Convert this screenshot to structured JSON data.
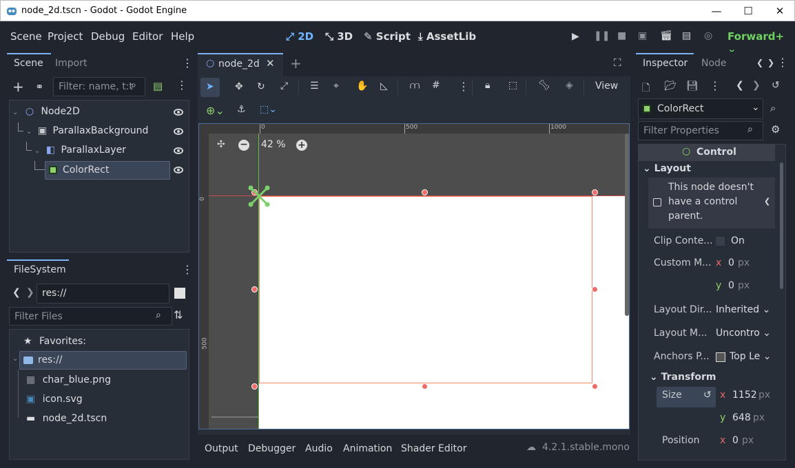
{
  "window": {
    "title": "node_2d.tscn - Godot - Godot Engine",
    "minimize": "—",
    "maximize": "☐",
    "close": "✕"
  },
  "menu": [
    "Scene",
    "Project",
    "Debug",
    "Editor",
    "Help"
  ],
  "workspaces": [
    {
      "label": "2D",
      "icon": "2d-icon",
      "active": true
    },
    {
      "label": "3D",
      "icon": "3d-icon",
      "active": false
    },
    {
      "label": "Script",
      "icon": "script-icon",
      "active": false
    },
    {
      "label": "AssetLib",
      "icon": "assetlib-icon",
      "active": false
    }
  ],
  "renderer": "Forward+",
  "scene_dock": {
    "tabs": [
      "Scene",
      "Import"
    ],
    "filter_placeholder": "Filter: name, t:t",
    "nodes": [
      {
        "label": "Node2D",
        "icon": "node2d-icon"
      },
      {
        "label": "ParallaxBackground",
        "icon": "parallax-background-icon"
      },
      {
        "label": "ParallaxLayer",
        "icon": "parallax-layer-icon"
      },
      {
        "label": "ColorRect",
        "icon": "colorrect-icon",
        "selected": true
      }
    ]
  },
  "filesystem": {
    "tab": "FileSystem",
    "path": "res://",
    "filter_placeholder": "Filter Files",
    "items": [
      {
        "label": "Favorites:",
        "icon": "star-icon"
      },
      {
        "label": "res://",
        "icon": "folder-icon",
        "selected": true
      },
      {
        "label": "char_blue.png",
        "icon": "image-icon"
      },
      {
        "label": "icon.svg",
        "icon": "svg-icon"
      },
      {
        "label": "node_2d.tscn",
        "icon": "scene-icon"
      }
    ]
  },
  "editor": {
    "tab": "node_2d",
    "zoom": "42 %",
    "view_menu": "View",
    "ruler_top": [
      "0",
      "500",
      "1000"
    ],
    "ruler_left": [
      "0",
      "500"
    ]
  },
  "bottom_panel": {
    "tabs": [
      "Output",
      "Debugger",
      "Audio",
      "Animation",
      "Shader Editor"
    ],
    "version": "4.2.1.stable.mono"
  },
  "inspector": {
    "tabs": [
      "Inspector",
      "Node"
    ],
    "node_selector": "ColorRect",
    "filter_placeholder": "Filter Properties",
    "class_header": "Control",
    "section_layout": "Layout",
    "warning": "This node doesn't have a control parent.",
    "props": {
      "clip_contents": {
        "label": "Clip Conte...",
        "value": "On"
      },
      "custom_min": {
        "label": "Custom M...",
        "x": "0",
        "y": "0",
        "unit": "px"
      },
      "layout_dir": {
        "label": "Layout Dir...",
        "value": "Inherited"
      },
      "layout_mode": {
        "label": "Layout M...",
        "value": "Uncontro"
      },
      "anchors_preset": {
        "label": "Anchors P...",
        "value": "Top Le"
      }
    },
    "section_transform": "Transform",
    "transform": {
      "size": {
        "label": "Size",
        "x": "1152",
        "y": "648",
        "unit": "px"
      },
      "position": {
        "label": "Position",
        "x": "0",
        "unit": "px"
      }
    },
    "axis_x": "x",
    "axis_y": "y"
  }
}
